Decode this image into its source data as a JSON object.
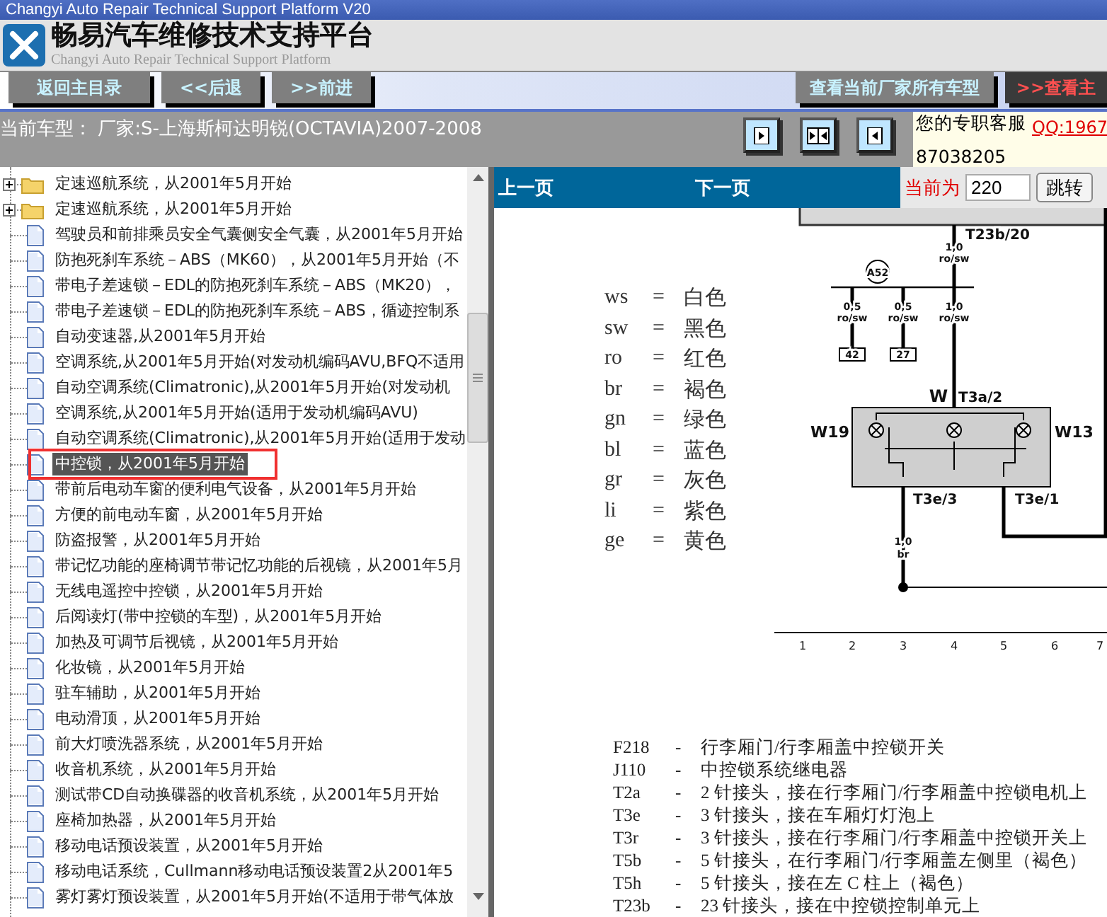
{
  "window": {
    "title": "Changyi Auto Repair Technical Support Platform V20"
  },
  "header": {
    "title": "畅易汽车维修技术支持平台",
    "subtitle": "Changyi Auto Repair Technical Support Platform"
  },
  "nav_buttons": [
    {
      "label": "返回主目录",
      "kind": "plain"
    },
    {
      "label": "<<后退",
      "kind": "plain"
    },
    {
      "label": ">>前进",
      "kind": "plain"
    }
  ],
  "right_buttons": [
    {
      "label": "查看当前厂家所有车型",
      "kind": "plain"
    },
    {
      "label": ">>查看主",
      "kind": "alert"
    }
  ],
  "vehicle": {
    "label": "当前车型：",
    "value": "厂家:S-上海斯柯达明锐(OCTAVIA)2007-2008"
  },
  "view_buttons": [
    {
      "kind": "right"
    },
    {
      "kind": "split"
    },
    {
      "kind": "left"
    }
  ],
  "support": {
    "label": "您的专职客服",
    "qq": "QQ:1967",
    "phone": "87038205"
  },
  "tree": [
    {
      "kind": "folder",
      "label": "定速巡航系统，从2001年5月开始",
      "expanded": false,
      "selected": false
    },
    {
      "kind": "folder",
      "label": "定速巡航系统，从2001年5月开始",
      "expanded": false,
      "selected": false
    },
    {
      "kind": "page",
      "label": "驾驶员和前排乘员安全气囊侧安全气囊，从2001年5月开始",
      "selected": false
    },
    {
      "kind": "page",
      "label": "防抱死刹车系统－ABS（MK60），从2001年5月开始（不",
      "selected": false
    },
    {
      "kind": "page",
      "label": "带电子差速锁－EDL的防抱死刹车系统－ABS（MK20），",
      "selected": false
    },
    {
      "kind": "page",
      "label": "带电子差速锁－EDL的防抱死刹车系统－ABS，循迹控制系",
      "selected": false
    },
    {
      "kind": "page",
      "label": "自动变速器,从2001年5月开始",
      "selected": false
    },
    {
      "kind": "page",
      "label": "空调系统,从2001年5月开始(对发动机编码AVU,BFQ不适用",
      "selected": false
    },
    {
      "kind": "page",
      "label": "自动空调系统(Climatronic),从2001年5月开始(对发动机",
      "selected": false
    },
    {
      "kind": "page",
      "label": "空调系统,从2001年5月开始(适用于发动机编码AVU)",
      "selected": false
    },
    {
      "kind": "page",
      "label": "自动空调系统(Climatronic),从2001年5月开始(适用于发动",
      "selected": false
    },
    {
      "kind": "page",
      "label": "中控锁，从2001年5月开始",
      "selected": true
    },
    {
      "kind": "page",
      "label": "带前后电动车窗的便利电气设备，从2001年5月开始",
      "selected": false
    },
    {
      "kind": "page",
      "label": "方便的前电动车窗，从2001年5月开始",
      "selected": false
    },
    {
      "kind": "page",
      "label": "防盗报警，从2001年5月开始",
      "selected": false
    },
    {
      "kind": "page",
      "label": "带记忆功能的座椅调节带记忆功能的后视镜，从2001年5月",
      "selected": false
    },
    {
      "kind": "page",
      "label": "无线电遥控中控锁，从2001年5月开始",
      "selected": false
    },
    {
      "kind": "page",
      "label": "后阅读灯(带中控锁的车型)，从2001年5月开始",
      "selected": false
    },
    {
      "kind": "page",
      "label": "加热及可调节后视镜，从2001年5月开始",
      "selected": false
    },
    {
      "kind": "page",
      "label": "化妆镜，从2001年5月开始",
      "selected": false
    },
    {
      "kind": "page",
      "label": "驻车辅助，从2001年5月开始",
      "selected": false
    },
    {
      "kind": "page",
      "label": "电动滑顶，从2001年5月开始",
      "selected": false
    },
    {
      "kind": "page",
      "label": "前大灯喷洗器系统，从2001年5月开始",
      "selected": false
    },
    {
      "kind": "page",
      "label": "收音机系统，从2001年5月开始",
      "selected": false
    },
    {
      "kind": "page",
      "label": "测试带CD自动换碟器的收音机系统，从2001年5月开始",
      "selected": false
    },
    {
      "kind": "page",
      "label": "座椅加热器，从2001年5月开始",
      "selected": false
    },
    {
      "kind": "page",
      "label": "移动电话预设装置，从2001年5月开始",
      "selected": false
    },
    {
      "kind": "page",
      "label": "移动电话系统，Cullmann移动电话预设装置2从2001年5",
      "selected": false
    },
    {
      "kind": "page",
      "label": "雾灯雾灯预设装置，从2001年5月开始(不适用于带气体放",
      "selected": false
    }
  ],
  "pager": {
    "prev": "上一页",
    "next": "下一页",
    "current_label": "当前为",
    "page": "220",
    "go": "跳转"
  },
  "legend": [
    {
      "code": "ws",
      "sep": "=",
      "name": "白色"
    },
    {
      "code": "sw",
      "sep": "=",
      "name": "黑色"
    },
    {
      "code": "ro",
      "sep": "=",
      "name": "红色"
    },
    {
      "code": "br",
      "sep": "=",
      "name": "褐色"
    },
    {
      "code": "gn",
      "sep": "=",
      "name": "绿色"
    },
    {
      "code": "bl",
      "sep": "=",
      "name": "蓝色"
    },
    {
      "code": "gr",
      "sep": "=",
      "name": "灰色"
    },
    {
      "code": "li",
      "sep": "=",
      "name": "紫色"
    },
    {
      "code": "ge",
      "sep": "=",
      "name": "黄色"
    }
  ],
  "diagram": {
    "labels": [
      "T23b/20",
      "1,0",
      "ro/sw",
      "A52",
      "0,5",
      "ro/sw",
      "0,5",
      "ro/sw",
      "1,0",
      "ro/sw",
      "42",
      "27",
      "W",
      "T3a/2",
      "W19",
      "W13",
      "T3e/3",
      "T3e/1",
      "1,0",
      "br"
    ],
    "axis": [
      "1",
      "2",
      "3",
      "4",
      "5",
      "6",
      "7"
    ]
  },
  "parts": [
    {
      "code": "F218",
      "sep": "-",
      "desc": "行李厢门/行李厢盖中控锁开关"
    },
    {
      "code": "J110",
      "sep": "-",
      "desc": "中控锁系统继电器"
    },
    {
      "code": "T2a",
      "sep": "-",
      "desc": "2 针接头，接在行李厢门/行李厢盖中控锁电机上"
    },
    {
      "code": "T3e",
      "sep": "-",
      "desc": "3 针接头，接在车厢灯灯泡上"
    },
    {
      "code": "T3r",
      "sep": "-",
      "desc": "3 针接头，接在行李厢门/行李厢盖中控锁开关上"
    },
    {
      "code": "T5b",
      "sep": "-",
      "desc": "5 针接头，在行李厢门/行李厢盖左侧里（褐色）"
    },
    {
      "code": "T5h",
      "sep": "-",
      "desc": "5 针接头，接在左 C 柱上（褐色）"
    },
    {
      "code": "T23b",
      "sep": "-",
      "desc": "23 针接头，接在中控锁控制单元上"
    }
  ]
}
